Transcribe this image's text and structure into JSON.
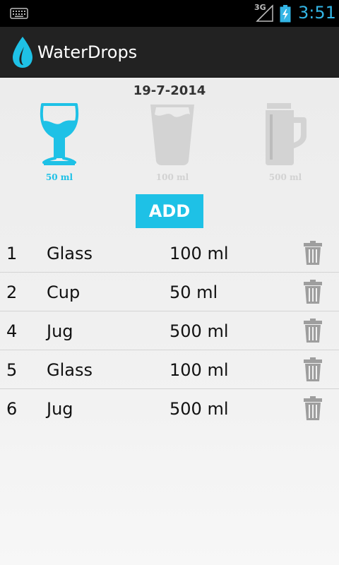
{
  "status_bar": {
    "network": "3G",
    "time": "3:51"
  },
  "action_bar": {
    "title": "WaterDrops"
  },
  "main": {
    "date": "19-7-2014",
    "vessels": [
      {
        "name": "Glass",
        "label": "50 ml",
        "selected": true
      },
      {
        "name": "Cup",
        "label": "100 ml",
        "selected": false
      },
      {
        "name": "Jug",
        "label": "500 ml",
        "selected": false
      }
    ],
    "add_label": "ADD",
    "entries": [
      {
        "id": "1",
        "type": "Glass",
        "volume": "100 ml"
      },
      {
        "id": "2",
        "type": "Cup",
        "volume": "50 ml"
      },
      {
        "id": "4",
        "type": "Jug",
        "volume": "500 ml"
      },
      {
        "id": "5",
        "type": "Glass",
        "volume": "100 ml"
      },
      {
        "id": "6",
        "type": "Jug",
        "volume": "500 ml"
      }
    ]
  },
  "colors": {
    "accent": "#1ec1e6",
    "status_time": "#33b5e5",
    "action_bar": "#222222",
    "inactive_icon": "#d3d3d3",
    "trash_icon": "#9e9e9e"
  },
  "icons": [
    "keyboard-icon",
    "signal-3g-icon",
    "battery-icon",
    "water-drop-logo",
    "wine-glass-icon",
    "cup-icon",
    "jug-icon",
    "trash-icon"
  ]
}
